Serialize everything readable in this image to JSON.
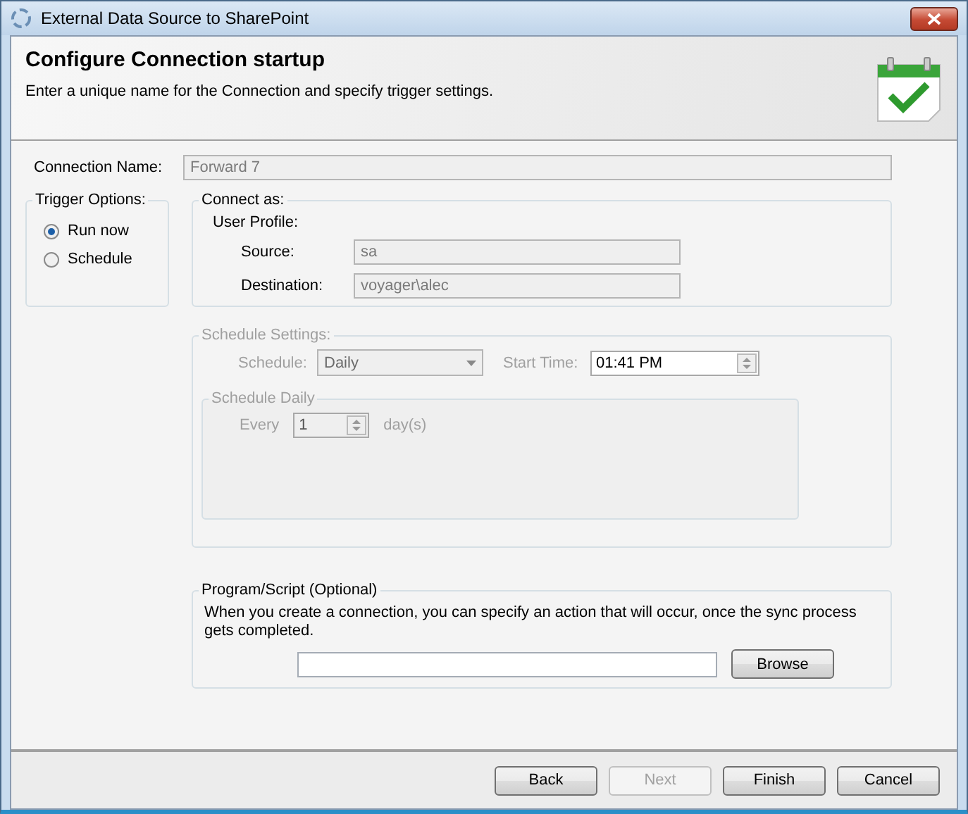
{
  "window": {
    "title": "External Data Source to SharePoint"
  },
  "header": {
    "title": "Configure Connection startup",
    "subtitle": "Enter a unique name for the Connection and specify trigger settings."
  },
  "connection_name": {
    "label": "Connection Name:",
    "value": "Forward 7",
    "disabled": true
  },
  "trigger_options": {
    "title": "Trigger Options:",
    "options": [
      {
        "label": "Run now",
        "selected": true
      },
      {
        "label": "Schedule",
        "selected": false
      }
    ]
  },
  "connect_as": {
    "title": "Connect as:",
    "profile_label": "User Profile:",
    "fields": [
      {
        "label": "Source:",
        "value": "sa"
      },
      {
        "label": "Destination:",
        "value": "voyager\\alec"
      }
    ]
  },
  "schedule_settings": {
    "title": "Schedule Settings:",
    "disabled": true,
    "schedule_label": "Schedule:",
    "schedule_value": "Daily",
    "start_time_label": "Start Time:",
    "start_time_value": "01:41 PM",
    "daily": {
      "title": "Schedule Daily",
      "every_label": "Every",
      "every_value": "1",
      "unit": "day(s)"
    }
  },
  "program_script": {
    "title": "Program/Script (Optional)",
    "description": "When you create a connection, you can specify an action that will occur, once the sync process gets completed.",
    "browse": "Browse"
  },
  "buttons": [
    {
      "label": "Back",
      "disabled": false
    },
    {
      "label": "Next",
      "disabled": true
    },
    {
      "label": "Finish",
      "disabled": false
    },
    {
      "label": "Cancel",
      "disabled": false
    }
  ]
}
